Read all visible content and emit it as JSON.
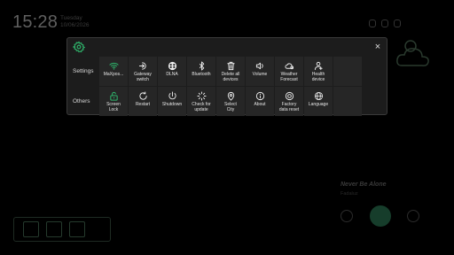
{
  "background": {
    "clock": "15:28",
    "date_line1": "Tuesday",
    "date_line2": "10/06/2026",
    "song_title": "Never Be Alone",
    "song_artist": "Fadaluz"
  },
  "panel": {
    "accent_color": "#2fb36b",
    "close_label": "×",
    "rows": [
      {
        "label": "Settings",
        "items": [
          {
            "label": "MaXpos...",
            "icon": "wifi-icon",
            "accent": true
          },
          {
            "label": "Gateway\nswitch",
            "icon": "gateway-switch-icon"
          },
          {
            "label": "DLNA",
            "icon": "dlna-icon"
          },
          {
            "label": "Bluetooth",
            "icon": "bluetooth-icon"
          },
          {
            "label": "Delete all\ndevices",
            "icon": "trash-icon"
          },
          {
            "label": "Volume",
            "icon": "volume-icon"
          },
          {
            "label": "Weather\nForecast",
            "icon": "weather-icon"
          },
          {
            "label": "Health\ndevice",
            "icon": "health-device-icon"
          },
          {
            "label": "",
            "icon": ""
          }
        ]
      },
      {
        "label": "Others",
        "items": [
          {
            "label": "Screen\nLock",
            "icon": "lock-icon",
            "accent": true
          },
          {
            "label": "Restart",
            "icon": "restart-icon"
          },
          {
            "label": "Shutdown",
            "icon": "power-icon"
          },
          {
            "label": "Check for\nupdate",
            "icon": "update-icon"
          },
          {
            "label": "Select\nCity",
            "icon": "location-icon"
          },
          {
            "label": "About",
            "icon": "info-icon"
          },
          {
            "label": "Factory\ndata reset",
            "icon": "factory-reset-icon"
          },
          {
            "label": "Language",
            "icon": "globe-icon"
          },
          {
            "label": "",
            "icon": ""
          }
        ]
      }
    ]
  }
}
